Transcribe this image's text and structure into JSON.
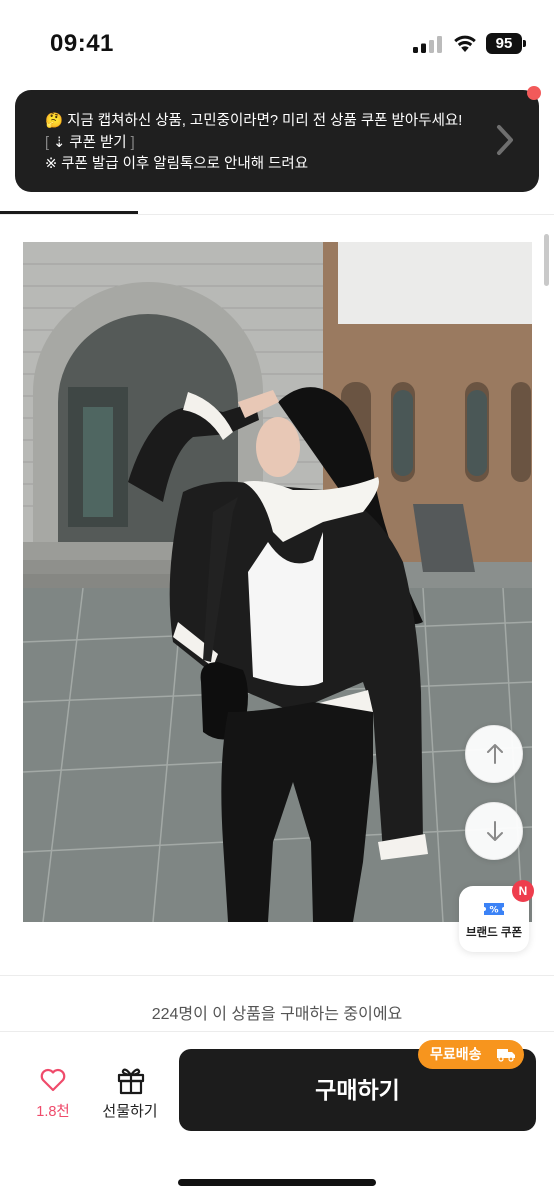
{
  "status_bar": {
    "time": "09:41",
    "battery": "95"
  },
  "coupon_banner": {
    "line1_emoji": "🤔",
    "line1": "지금 캡쳐하신 상품, 고민중이라면? 미리 전 상품 쿠폰 받아두세요!",
    "line2_open": "[",
    "line2": "⇣ 쿠폰 받기",
    "line2_close": "]",
    "line3": "※ 쿠폰 발급 이후 알림톡으로 안내해 드려요"
  },
  "floating": {
    "brand_coupon_label": "브랜드 쿠폰",
    "new_badge": "N"
  },
  "purchase_status": "224명이 이 상품을 구매하는 중이에요",
  "bottom_bar": {
    "like_count": "1.8천",
    "gift_label": "선물하기",
    "buy_label": "구매하기",
    "free_shipping": "무료배송"
  },
  "colors": {
    "banner_bg": "#1f1f1f",
    "accent_pink": "#ef4b6b",
    "badge_red": "#ee3d4d",
    "shipping_orange": "#f7951e",
    "buy_button_bg": "#1c1c1c"
  }
}
